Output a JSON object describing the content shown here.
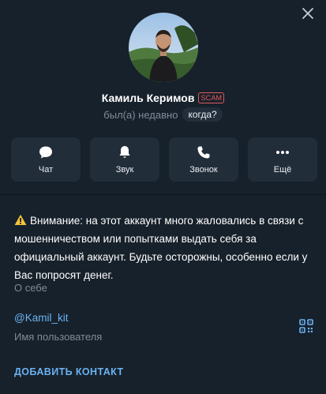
{
  "profile": {
    "name": "Камиль Керимов",
    "scam_badge": "SCAM",
    "status": "был(а) недавно",
    "when_button": "когда?"
  },
  "actions": [
    {
      "label": "Чат",
      "icon": "chat-icon"
    },
    {
      "label": "Звук",
      "icon": "bell-icon"
    },
    {
      "label": "Звонок",
      "icon": "phone-icon"
    },
    {
      "label": "Ещё",
      "icon": "more-icon"
    }
  ],
  "warning": {
    "icon": "warning-icon",
    "text": "Внимание: на этот аккаунт много жаловались в связи с мошенничеством или попытками выдать себя за официальный аккаунт. Будьте осторожны, особенно если у Вас попросят денег."
  },
  "about": {
    "label": "О себе"
  },
  "username": {
    "value": "@Kamil_kit",
    "label": "Имя пользователя",
    "qr_icon": "qr-code-icon"
  },
  "add_contact": "ДОБАВИТЬ КОНТАКТ",
  "colors": {
    "background": "#17212b",
    "card": "#222d3a",
    "accent": "#6ab3f3",
    "scam": "#e05a5a",
    "muted": "#7d8b99"
  }
}
